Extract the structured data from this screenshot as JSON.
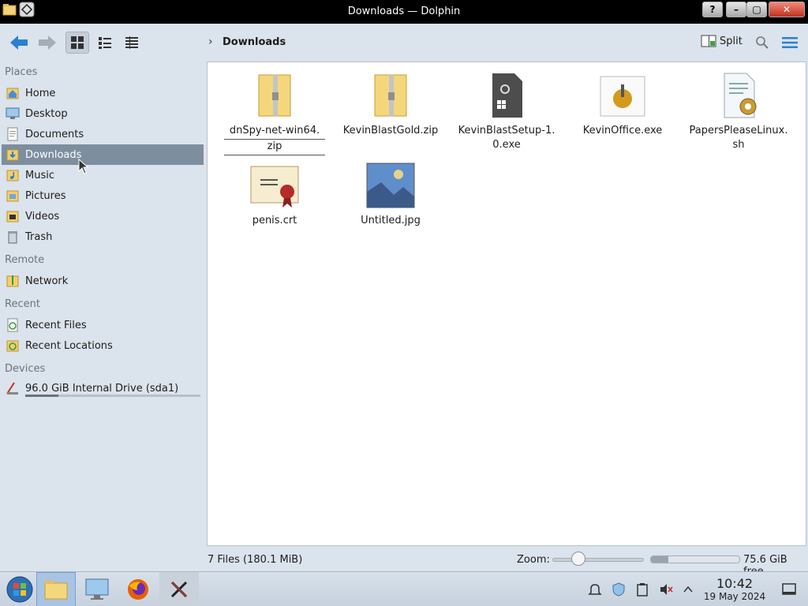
{
  "window": {
    "title": "Downloads — Dolphin",
    "buttons": {
      "help": "?",
      "minimize": "–",
      "maximize": "▢",
      "close": "✕"
    }
  },
  "toolbar": {
    "breadcrumb": "Downloads",
    "split_label": "Split"
  },
  "sidebar": {
    "sections": {
      "places": "Places",
      "remote": "Remote",
      "recent": "Recent",
      "devices": "Devices"
    },
    "places": [
      {
        "label": "Home",
        "icon": "home-icon"
      },
      {
        "label": "Desktop",
        "icon": "desktop-icon"
      },
      {
        "label": "Documents",
        "icon": "documents-icon"
      },
      {
        "label": "Downloads",
        "icon": "downloads-icon",
        "selected": true
      },
      {
        "label": "Music",
        "icon": "music-icon"
      },
      {
        "label": "Pictures",
        "icon": "pictures-icon"
      },
      {
        "label": "Videos",
        "icon": "videos-icon"
      },
      {
        "label": "Trash",
        "icon": "trash-icon"
      }
    ],
    "remote": [
      {
        "label": "Network",
        "icon": "network-icon"
      }
    ],
    "recent": [
      {
        "label": "Recent Files",
        "icon": "recent-files-icon"
      },
      {
        "label": "Recent Locations",
        "icon": "recent-locations-icon"
      }
    ],
    "devices": [
      {
        "label": "96.0 GiB Internal Drive (sda1)",
        "icon": "drive-icon",
        "usage": 0.19
      }
    ]
  },
  "files": [
    {
      "name": "dnSpy-net-win64.zip",
      "line1": "dnSpy-net-win64.",
      "line2": "zip",
      "icon": "zip-folder-icon"
    },
    {
      "name": "KevinBlastGold.zip",
      "line1": "KevinBlastGold.zip",
      "line2": "",
      "icon": "zip-folder-icon"
    },
    {
      "name": "KevinBlastSetup-1.0.exe",
      "line1": "KevinBlastSetup-1.",
      "line2": "0.exe",
      "icon": "executable-icon"
    },
    {
      "name": "KevinOffice.exe",
      "line1": "KevinOffice.exe",
      "line2": "",
      "icon": "application-icon"
    },
    {
      "name": "PapersPleaseLinux.sh",
      "line1": "PapersPleaseLinux.",
      "line2": "sh",
      "icon": "script-icon"
    },
    {
      "name": "penis.crt",
      "line1": "penis.crt",
      "line2": "",
      "icon": "certificate-icon"
    },
    {
      "name": "Untitled.jpg",
      "line1": "Untitled.jpg",
      "line2": "",
      "icon": "image-thumbnail-icon"
    }
  ],
  "status": {
    "count": "7 Files (180.1 MiB)",
    "zoom_label": "Zoom:",
    "free": "75.6 GiB free",
    "zoom_level": 0.25,
    "disk_used": 0.2
  },
  "taskbar": {
    "time": "10:42",
    "date": "19 May 2024"
  },
  "colors": {
    "selection": "#7d8e9f",
    "accent": "#2a7fd4",
    "background": "#dbe3ec"
  }
}
